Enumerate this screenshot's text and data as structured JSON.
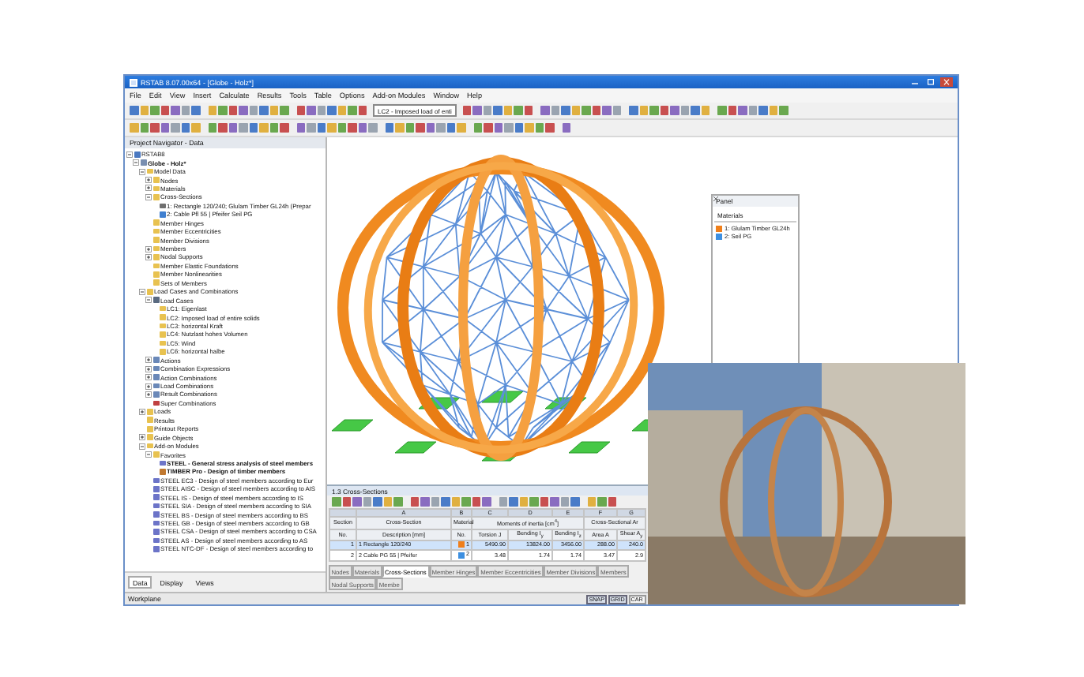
{
  "window": {
    "title": "RSTAB 8.07.00x64 - [Globe - Holz*]"
  },
  "menu": [
    "File",
    "Edit",
    "View",
    "Insert",
    "Calculate",
    "Results",
    "Tools",
    "Table",
    "Options",
    "Add-on Modules",
    "Window",
    "Help"
  ],
  "toolbar": {
    "load_case": "LC2 - Imposed load of enti"
  },
  "navigator": {
    "title": "Project Navigator - Data",
    "tree": [
      {
        "label": "RSTAB8",
        "kind": "root",
        "expanded": true,
        "children": [
          {
            "label": "Globe - Holz*",
            "kind": "project",
            "bold": true,
            "expanded": true,
            "children": [
              {
                "label": "Model Data",
                "kind": "folder",
                "expanded": true,
                "children": [
                  {
                    "label": "Nodes",
                    "kind": "folder",
                    "expanded": false
                  },
                  {
                    "label": "Materials",
                    "kind": "folder",
                    "expanded": false
                  },
                  {
                    "label": "Cross-Sections",
                    "kind": "folder",
                    "expanded": true,
                    "children": [
                      {
                        "label": "1: Rectangle 120/240; Glulam Timber GL24h (Prepar",
                        "kind": "section"
                      },
                      {
                        "label": "2: Cable Pfl 55 | Pfeifer Seil PG",
                        "kind": "cable"
                      }
                    ]
                  },
                  {
                    "label": "Member Hinges",
                    "kind": "folder"
                  },
                  {
                    "label": "Member Eccentricities",
                    "kind": "folder"
                  },
                  {
                    "label": "Member Divisions",
                    "kind": "folder"
                  },
                  {
                    "label": "Members",
                    "kind": "folder",
                    "expanded": false
                  },
                  {
                    "label": "Nodal Supports",
                    "kind": "folder",
                    "expanded": false
                  },
                  {
                    "label": "Member Elastic Foundations",
                    "kind": "folder"
                  },
                  {
                    "label": "Member Nonlinearities",
                    "kind": "folder"
                  },
                  {
                    "label": "Sets of Members",
                    "kind": "folder"
                  }
                ]
              },
              {
                "label": "Load Cases and Combinations",
                "kind": "folder",
                "expanded": true,
                "children": [
                  {
                    "label": "Load Cases",
                    "kind": "loadcases",
                    "expanded": true,
                    "children": [
                      {
                        "label": "LC1: Eigenlast",
                        "kind": "folder"
                      },
                      {
                        "label": "LC2: Imposed load of entire solids",
                        "kind": "folder"
                      },
                      {
                        "label": "LC3: horizontal Kraft",
                        "kind": "folder"
                      },
                      {
                        "label": "LC4: Nutzlast hohes Volumen",
                        "kind": "folder"
                      },
                      {
                        "label": "LC5: Wind",
                        "kind": "folder"
                      },
                      {
                        "label": "LC6: horizontal halbe",
                        "kind": "folder"
                      }
                    ]
                  },
                  {
                    "label": "Actions",
                    "kind": "combination",
                    "expanded": false
                  },
                  {
                    "label": "Combination Expressions",
                    "kind": "combination",
                    "expanded": false
                  },
                  {
                    "label": "Action Combinations",
                    "kind": "combination",
                    "expanded": false
                  },
                  {
                    "label": "Load Combinations",
                    "kind": "combination",
                    "expanded": false
                  },
                  {
                    "label": "Result Combinations",
                    "kind": "combination",
                    "expanded": false
                  },
                  {
                    "label": "Super Combinations",
                    "kind": "super"
                  }
                ]
              },
              {
                "label": "Loads",
                "kind": "folder",
                "expanded": false
              },
              {
                "label": "Results",
                "kind": "folder"
              },
              {
                "label": "Printout Reports",
                "kind": "folder"
              },
              {
                "label": "Guide Objects",
                "kind": "folder",
                "expanded": false
              },
              {
                "label": "Add-on Modules",
                "kind": "folder",
                "expanded": true,
                "children": [
                  {
                    "label": "Favorites",
                    "kind": "folder",
                    "expanded": true,
                    "children": [
                      {
                        "label": "STEEL - General stress analysis of steel members",
                        "kind": "module",
                        "bold": true
                      },
                      {
                        "label": "TIMBER Pro - Design of timber members",
                        "kind": "timber",
                        "bold": true
                      }
                    ]
                  },
                  {
                    "label": "STEEL EC3 - Design of steel members according to Eur",
                    "kind": "module"
                  },
                  {
                    "label": "STEEL AISC - Design of steel members according to AIS",
                    "kind": "module"
                  },
                  {
                    "label": "STEEL IS - Design of steel members according to IS",
                    "kind": "module"
                  },
                  {
                    "label": "STEEL SIA - Design of steel members according to SIA",
                    "kind": "module"
                  },
                  {
                    "label": "STEEL BS - Design of steel members according to BS",
                    "kind": "module"
                  },
                  {
                    "label": "STEEL GB - Design of steel members according to GB",
                    "kind": "module"
                  },
                  {
                    "label": "STEEL CSA - Design of steel members according to CSA",
                    "kind": "module"
                  },
                  {
                    "label": "STEEL AS - Design of steel members according to AS",
                    "kind": "module"
                  },
                  {
                    "label": "STEEL NTC-DF - Design of steel members according to",
                    "kind": "module"
                  }
                ]
              }
            ]
          }
        ]
      }
    ],
    "tabs": [
      {
        "label": "Data",
        "selected": true
      },
      {
        "label": "Display",
        "selected": false
      },
      {
        "label": "Views",
        "selected": false
      }
    ]
  },
  "panel": {
    "title": "Panel",
    "section": "Materials",
    "items": [
      {
        "label": "1: Glulam Timber GL24h",
        "color": "#f07f1a"
      },
      {
        "label": "2: Seil PG",
        "color": "#3d8fe0"
      }
    ]
  },
  "table": {
    "title": "1.3 Cross-Sections",
    "columns": [
      {
        "top": "Section",
        "label": "No."
      },
      {
        "letter": "A",
        "top": "Cross-Section",
        "label": "Description [mm]"
      },
      {
        "letter": "B",
        "top": "Material",
        "label": "No."
      },
      {
        "letter": "C",
        "group": "Moments of inertia [cm$^{4}$]",
        "label": "Torsion J"
      },
      {
        "letter": "D",
        "label": "Bending I$_{y}$"
      },
      {
        "letter": "E",
        "label": "Bending I$_{z}$"
      },
      {
        "letter": "F",
        "group": "Cross-Sectional Ar",
        "label": "Area A"
      },
      {
        "letter": "G",
        "label": "Shear A$_{y}$"
      }
    ],
    "rows": [
      {
        "selected": true,
        "color": "#f07f1a",
        "cells": [
          "1",
          "1 Rectangle 120/240",
          "1",
          "5490.90",
          "13824.00",
          "3456.00",
          "288.00",
          "240.0"
        ]
      },
      {
        "selected": false,
        "color": "#3d8fe0",
        "cells": [
          "2",
          "2 Cable PG 55 | Pfeifer",
          "2",
          "3.48",
          "1.74",
          "1.74",
          "3.47",
          "2.9"
        ]
      }
    ],
    "tabs": [
      {
        "label": "Nodes",
        "selected": false
      },
      {
        "label": "Materials",
        "selected": false
      },
      {
        "label": "Cross-Sections",
        "selected": true
      },
      {
        "label": "Member Hinges",
        "selected": false
      },
      {
        "label": "Member Eccentricities",
        "selected": false
      },
      {
        "label": "Member Divisions",
        "selected": false
      },
      {
        "label": "Members",
        "selected": false
      },
      {
        "label": "Nodal Supports",
        "selected": false
      },
      {
        "label": "Membe",
        "selected": false
      }
    ]
  },
  "status_bar": {
    "text": "Workplane",
    "toggles": [
      {
        "label": "SNAP",
        "on": true
      },
      {
        "label": "GRID",
        "on": true
      },
      {
        "label": "CAR",
        "on": false
      }
    ]
  }
}
